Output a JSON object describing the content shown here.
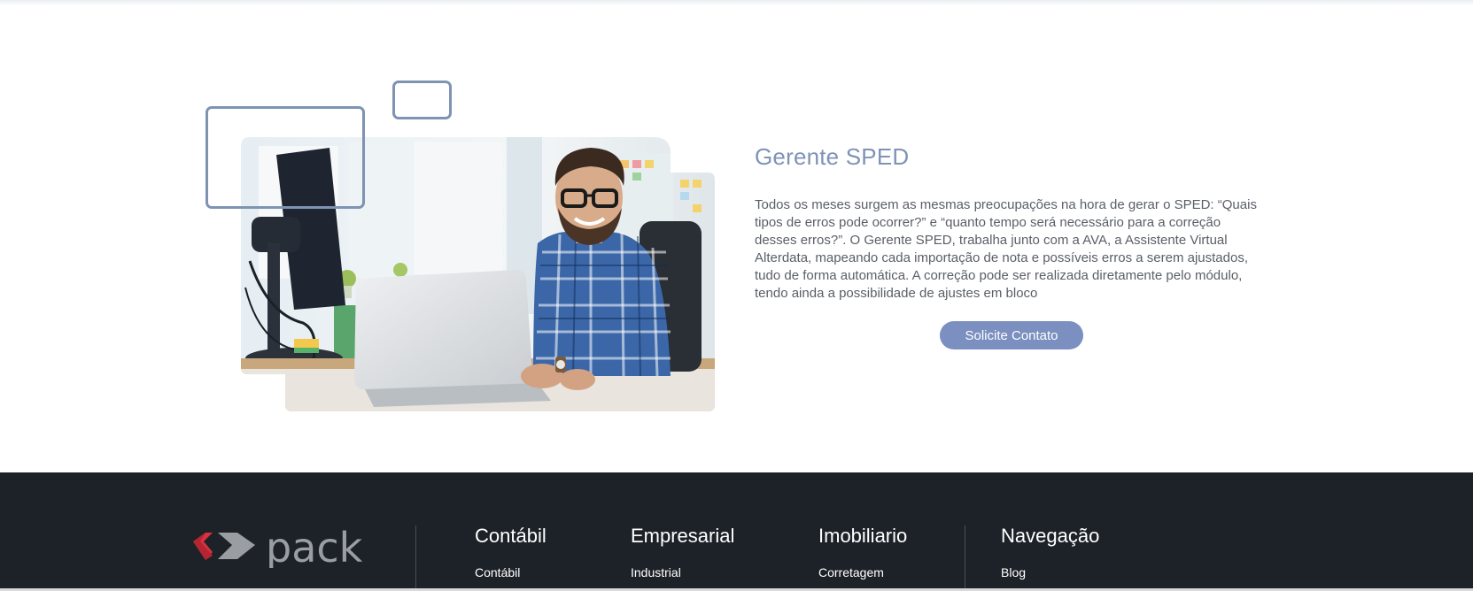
{
  "hero": {
    "title": "Gerente SPED",
    "description": "Todos os meses surgem as mesmas preocupações na hora de gerar o SPED: “Quais tipos de erros pode ocorrer?” e “quanto tempo será necessário para a correção desses erros?”. O Gerente SPED, trabalha junto com a AVA, a Assistente Virtual Alterdata, mapeando cada importação de nota e possíveis erros a serem ajustados, tudo de forma automática. A correção pode ser realizada diretamente pelo módulo, tendo ainda a possibilidade de ajustes em bloco",
    "cta_label": "Solicite Contato",
    "image_alt": "man-at-laptop-photo"
  },
  "footer": {
    "logo_text": "pack",
    "columns": [
      {
        "title": "Contábil",
        "links": [
          "Contábil"
        ]
      },
      {
        "title": "Empresarial",
        "links": [
          "Industrial"
        ]
      },
      {
        "title": "Imobiliario",
        "links": [
          "Corretagem"
        ]
      },
      {
        "title": "Navegação",
        "links": [
          "Blog"
        ]
      }
    ]
  },
  "colors": {
    "accent": "#7b8fc0",
    "title": "#7f93b6",
    "footer_bg": "#1d2228",
    "logo_red": "#d6323f",
    "logo_gray": "#9a9da2"
  }
}
